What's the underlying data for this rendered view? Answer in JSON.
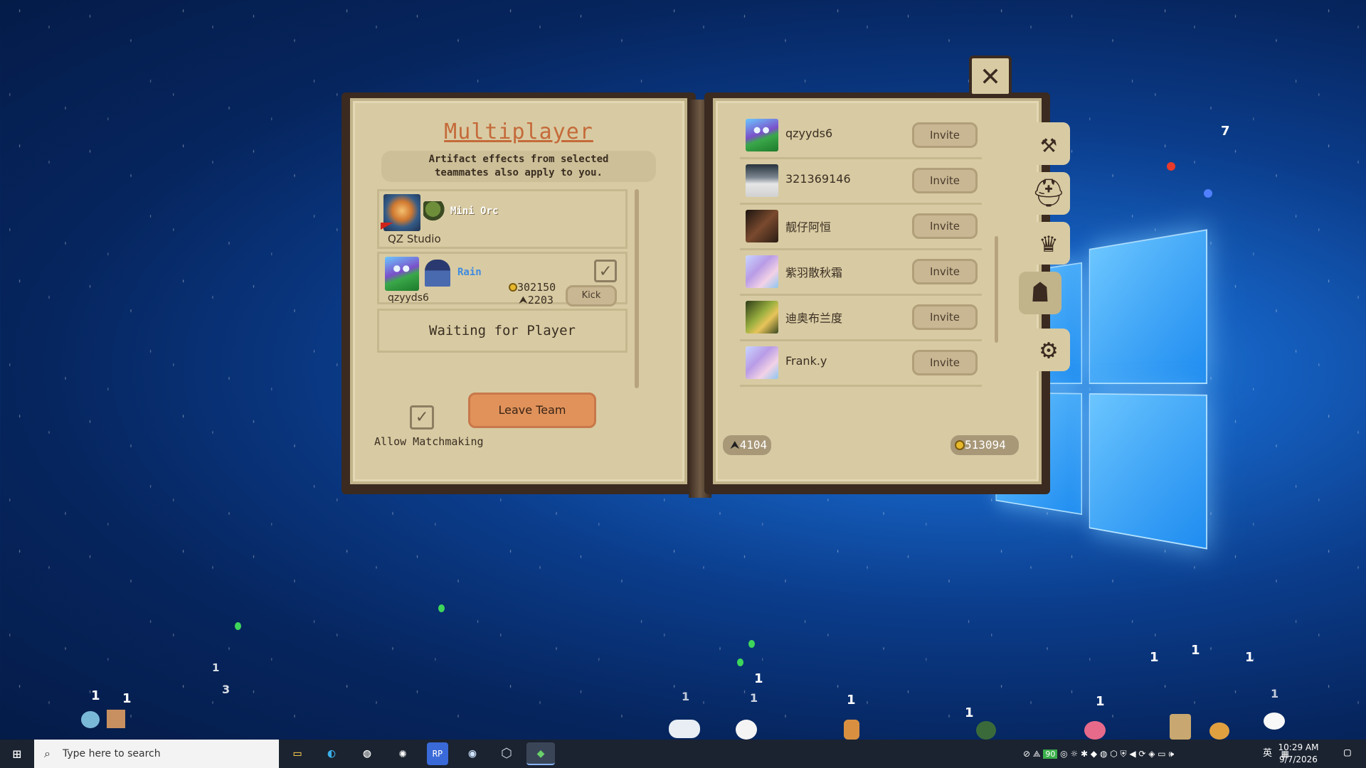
{
  "window": {
    "title": "Multiplayer",
    "subtitle_line1": "Artifact effects from selected",
    "subtitle_line2": "teammates also apply to you."
  },
  "team": {
    "members": [
      {
        "name": "QZ Studio",
        "pet": "Mini Orc",
        "role": "leader"
      },
      {
        "name": "qzyyds6",
        "pet": "Rain",
        "coins": "302150",
        "clicks": "2203",
        "kick_label": "Kick",
        "artifacts_checked": true
      }
    ],
    "waiting_label": "Waiting for Player",
    "allow_matchmaking_label": "Allow Matchmaking",
    "allow_matchmaking_checked": true,
    "leave_button_label": "Leave Team"
  },
  "friends": {
    "invite_label": "Invite",
    "list": [
      {
        "name": "qzyyds6",
        "avatar": "frog"
      },
      {
        "name": "321369146",
        "avatar": "cat"
      },
      {
        "name": "靓仔阿恒",
        "avatar": "dark"
      },
      {
        "name": "紫羽散秋霜",
        "avatar": "anime"
      },
      {
        "name": "迪奥布兰度",
        "avatar": "yellow"
      },
      {
        "name": "Frank.y",
        "avatar": "anime"
      }
    ],
    "clicks_total": "4104",
    "coins_total": "513094"
  },
  "side_tabs": [
    {
      "name": "hammer-icon"
    },
    {
      "name": "helmet-icon"
    },
    {
      "name": "crown-icon"
    },
    {
      "name": "multiplayer-icon",
      "active": true
    },
    {
      "name": "gear-icon"
    }
  ],
  "desktop": {
    "numbers": [
      "7",
      "1",
      "1",
      "1",
      "3",
      "1",
      "1",
      "1",
      "1",
      "1",
      "1",
      "1",
      "1",
      "1",
      "1"
    ]
  },
  "taskbar": {
    "search_placeholder": "Type here to search",
    "tray_count": "90",
    "ime": "英",
    "time": "10:29 AM",
    "date": "9/7/2026"
  },
  "colors": {
    "page": "#d8cba3",
    "title": "#c56a3a",
    "leave_button": "#e0925a",
    "pet_label": "#3f8be0"
  }
}
